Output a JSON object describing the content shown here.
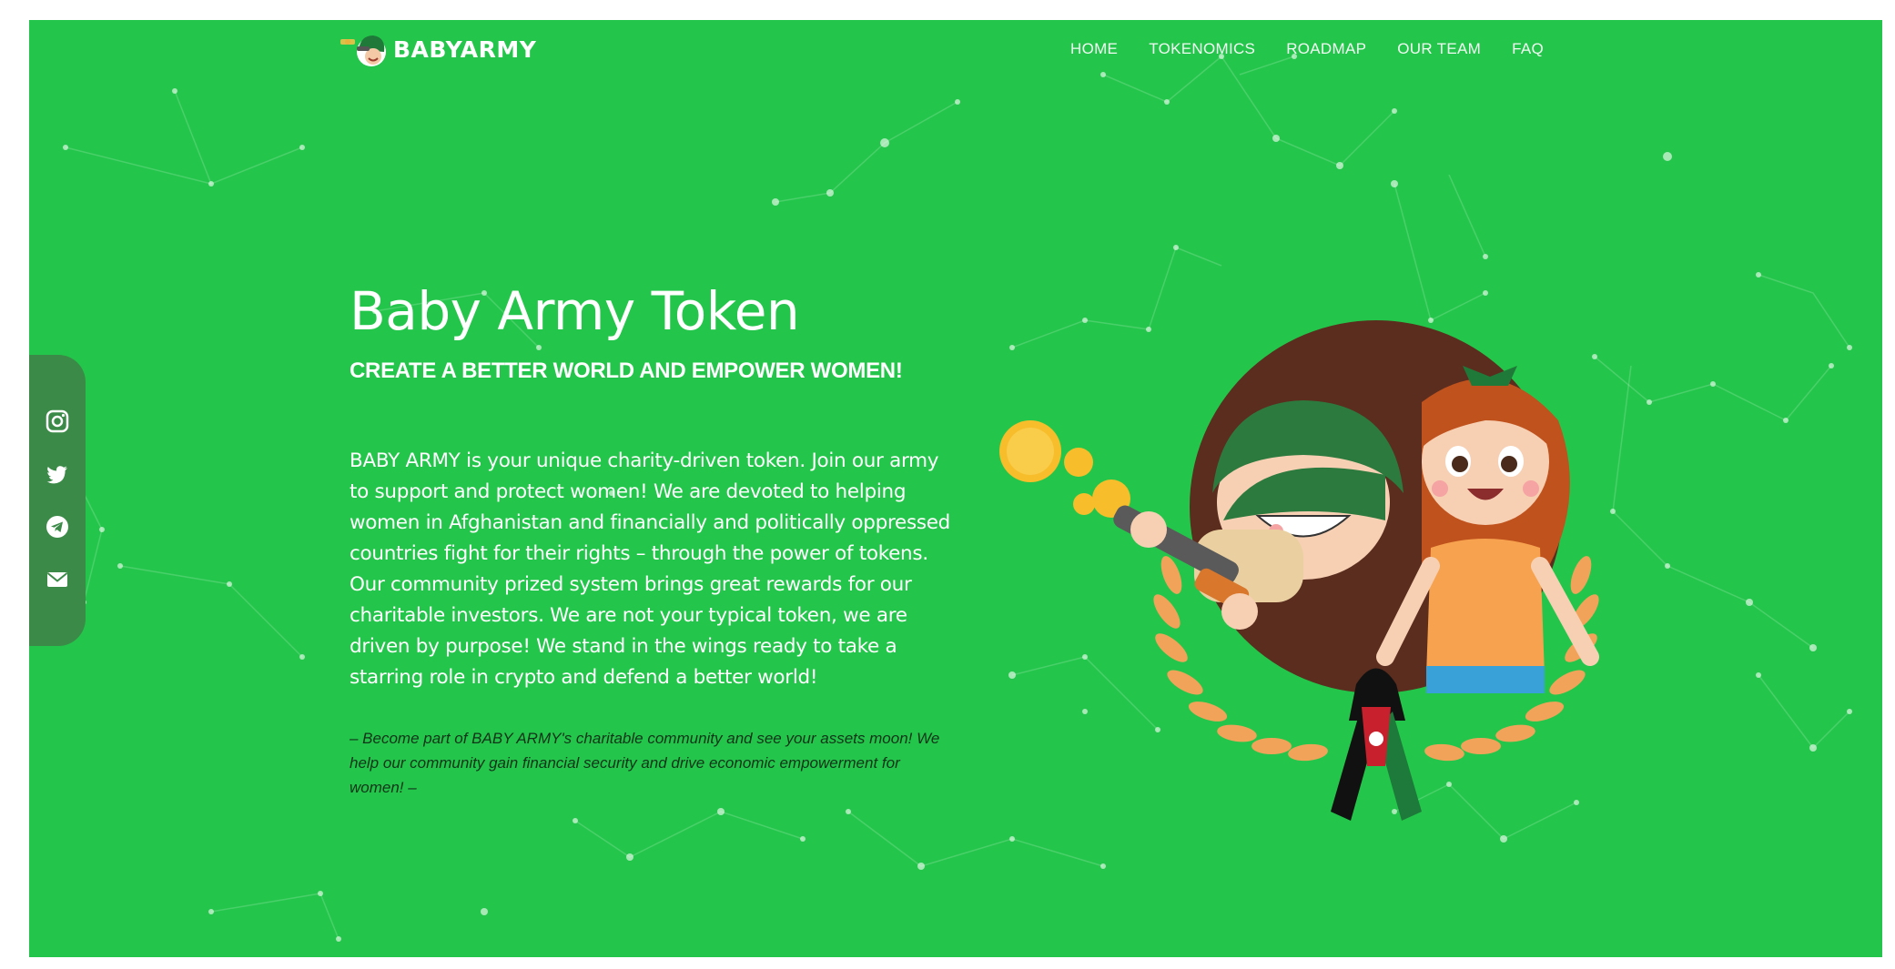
{
  "brand": {
    "name": "BABYARMY"
  },
  "nav": {
    "items": [
      {
        "label": "HOME"
      },
      {
        "label": "TOKENOMICS"
      },
      {
        "label": "ROADMAP"
      },
      {
        "label": "OUR TEAM"
      },
      {
        "label": "FAQ"
      }
    ]
  },
  "social": {
    "items": [
      {
        "icon": "instagram-icon"
      },
      {
        "icon": "twitter-icon"
      },
      {
        "icon": "telegram-icon"
      },
      {
        "icon": "email-icon"
      }
    ]
  },
  "hero": {
    "title": "Baby Army Token",
    "subtitle": "CREATE A BETTER WORLD AND EMPOWER WOMEN!",
    "body": "BABY ARMY is your unique charity-driven token. Join our army to support and protect women! We are devoted to helping women in Afghanistan and financially and politically oppressed countries fight for their rights – through the power of tokens. Our community prized system brings great rewards for our charitable investors. We are not your typical token, we are driven by purpose! We stand in the wings ready to take a starring role in crypto and defend a better world!",
    "quote": "– Become part of BABY ARMY's charitable community and see your assets moon! We help our community gain financial security and drive economic empowerment for women! –"
  },
  "colors": {
    "background": "#23c64a",
    "social_bar": "#3b8a48",
    "text": "#ffffff",
    "quote_text": "#11331a"
  }
}
